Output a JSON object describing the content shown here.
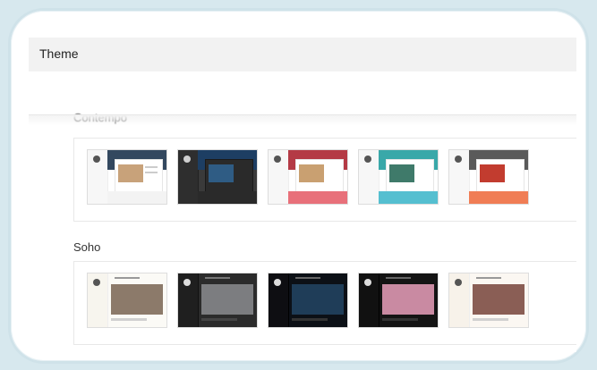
{
  "header": {
    "title": "Theme"
  },
  "sections": [
    {
      "label": "Contempo",
      "thumbnails": [
        {
          "name": "contempo-light",
          "band": "#33485f",
          "photo": "#c8a27a",
          "lower": "#f3f3f3",
          "side": "#f7f7f7",
          "bg": "#ffffff"
        },
        {
          "name": "contempo-dark",
          "band": "#1d3e63",
          "photo": "#2f5c84",
          "lower": "#2a2a2a",
          "side": "#2e2e2e",
          "bg": "#3a3a3a"
        },
        {
          "name": "contempo-red",
          "band": "#b43a45",
          "photo": "#c9a071",
          "lower": "#e8707a",
          "side": "#f7f7f7",
          "bg": "#ffffff"
        },
        {
          "name": "contempo-teal",
          "band": "#39a8a9",
          "photo": "#3f7a6a",
          "lower": "#55bfd0",
          "side": "#f7f7f7",
          "bg": "#ffffff"
        },
        {
          "name": "contempo-orange",
          "band": "#5a5a5a",
          "photo": "#c23c2f",
          "lower": "#f07d55",
          "side": "#f7f7f7",
          "bg": "#ffffff"
        }
      ]
    },
    {
      "label": "Soho",
      "thumbnails": [
        {
          "name": "soho-cat",
          "full": "#fbfaf6",
          "hero": "#8c7a6a",
          "side": "#f7f5ee"
        },
        {
          "name": "soho-interior",
          "full": "#2b2b2b",
          "hero": "#7c7d80",
          "side": "#1f1f1f"
        },
        {
          "name": "soho-space",
          "full": "#0c1016",
          "hero": "#1f3d58",
          "side": "#0e0e12"
        },
        {
          "name": "soho-flatlay",
          "full": "#141414",
          "hero": "#c98aa2",
          "side": "#111111"
        },
        {
          "name": "soho-table",
          "full": "#fbf7f2",
          "hero": "#8a5e55",
          "side": "#f7f2ea"
        }
      ]
    }
  ]
}
